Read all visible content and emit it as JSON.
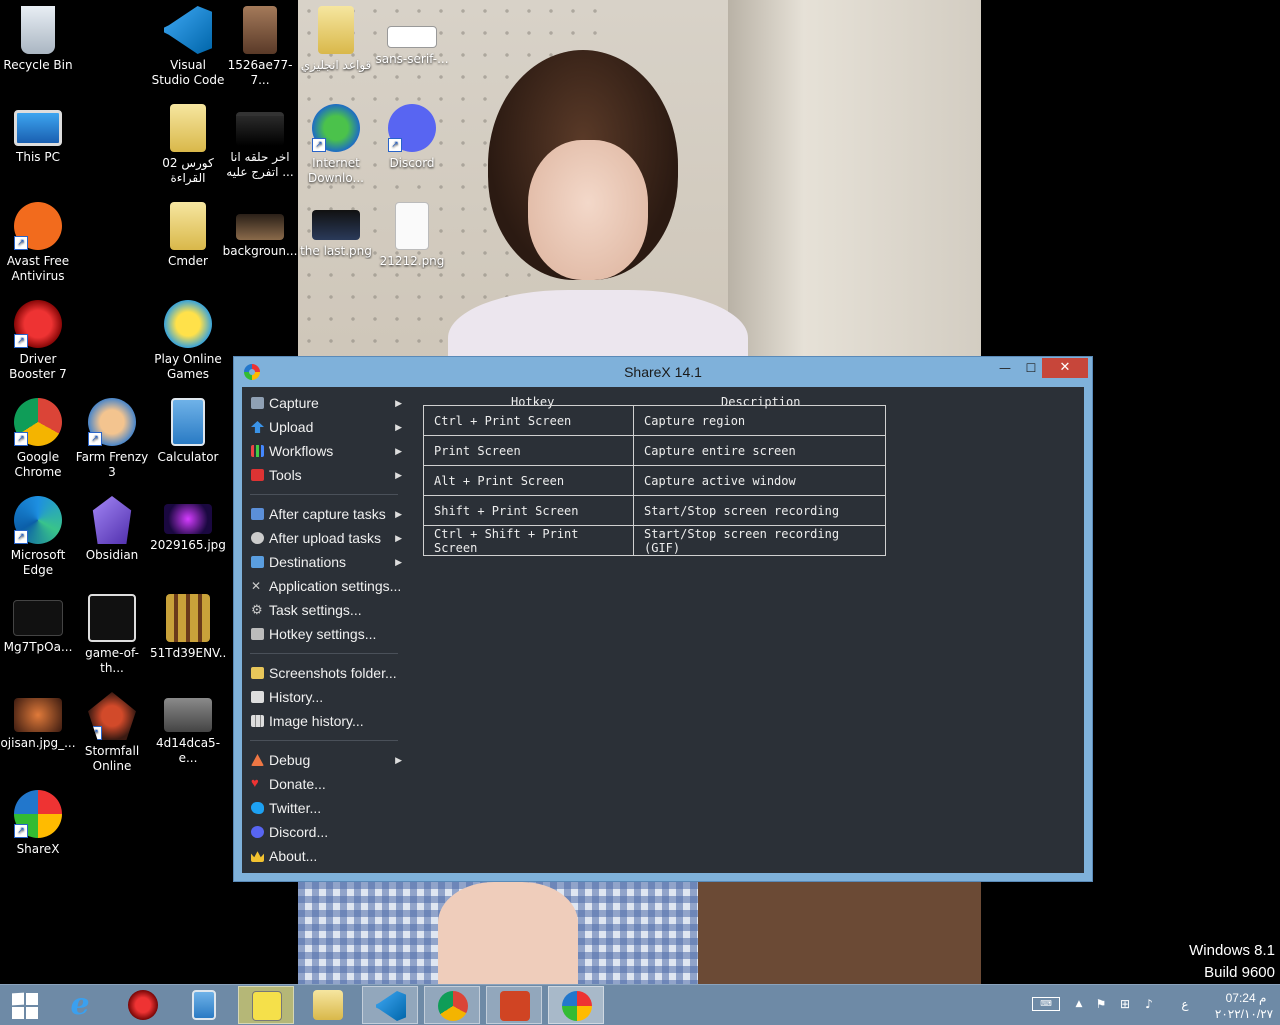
{
  "desktop": {
    "icons": [
      {
        "label": "Recycle Bin",
        "icon": "recycle-bin-icon"
      },
      {
        "label": "Visual Studio Code",
        "icon": "vscode-icon"
      },
      {
        "label": "1526ae77-7...",
        "icon": "image-thumbnail-icon"
      },
      {
        "label": "قواعد انجليزي",
        "icon": "folder-icon"
      },
      {
        "label": "sans-serif-...",
        "icon": "image-thumbnail-icon"
      },
      {
        "label": "This PC",
        "icon": "this-pc-icon"
      },
      {
        "label": "كورس 02 القراءة",
        "icon": "folder-icon"
      },
      {
        "label": "اخر حلقه انا اتفرج عليه ...",
        "icon": "image-thumbnail-icon"
      },
      {
        "label": "Internet Downlo...",
        "icon": "internet-download-manager-icon"
      },
      {
        "label": "Discord",
        "icon": "discord-icon"
      },
      {
        "label": "Avast Free Antivirus",
        "icon": "avast-icon"
      },
      {
        "label": "Cmder",
        "icon": "folder-icon"
      },
      {
        "label": "backgroun...",
        "icon": "image-thumbnail-icon"
      },
      {
        "label": "the last.png",
        "icon": "image-thumbnail-icon"
      },
      {
        "label": "21212.png",
        "icon": "png-file-icon"
      },
      {
        "label": "Driver Booster 7",
        "icon": "driver-booster-icon"
      },
      {
        "label": "Play Online Games",
        "icon": "games-icon"
      },
      {
        "label": "Google Chrome",
        "icon": "chrome-icon"
      },
      {
        "label": "Farm Frenzy 3",
        "icon": "farm-frenzy-icon"
      },
      {
        "label": "Calculator",
        "icon": "calculator-icon"
      },
      {
        "label": "Microsoft Edge",
        "icon": "edge-icon"
      },
      {
        "label": "Obsidian",
        "icon": "obsidian-icon"
      },
      {
        "label": "2029165.jpg",
        "icon": "image-thumbnail-icon"
      },
      {
        "label": "Mg7TpOa...",
        "icon": "image-thumbnail-icon"
      },
      {
        "label": "game-of-th...",
        "icon": "image-thumbnail-icon"
      },
      {
        "label": "51Td39ENV...",
        "icon": "image-thumbnail-icon"
      },
      {
        "label": "ojisan.jpg_...",
        "icon": "image-thumbnail-icon"
      },
      {
        "label": "Stormfall Online",
        "icon": "stormfall-icon"
      },
      {
        "label": "4d14dca5-e...",
        "icon": "image-thumbnail-icon"
      },
      {
        "label": "ShareX",
        "icon": "sharex-icon"
      }
    ]
  },
  "sharex": {
    "title": "ShareX 14.1",
    "menu": {
      "capture": "Capture",
      "upload": "Upload",
      "workflows": "Workflows",
      "tools": "Tools",
      "after_capture": "After capture tasks",
      "after_upload": "After upload tasks",
      "destinations": "Destinations",
      "app_settings": "Application settings...",
      "task_settings": "Task settings...",
      "hotkey_settings": "Hotkey settings...",
      "screenshots_folder": "Screenshots folder...",
      "history": "History...",
      "image_history": "Image history...",
      "debug": "Debug",
      "donate": "Donate...",
      "twitter": "Twitter...",
      "discord": "Discord...",
      "about": "About..."
    },
    "hotkeys": {
      "header_hotkey": "Hotkey",
      "header_description": "Description",
      "rows": [
        {
          "key": "Ctrl + Print Screen",
          "desc": "Capture region"
        },
        {
          "key": "Print Screen",
          "desc": "Capture entire screen"
        },
        {
          "key": "Alt + Print Screen",
          "desc": "Capture active window"
        },
        {
          "key": "Shift + Print Screen",
          "desc": "Start/Stop screen recording"
        },
        {
          "key": "Ctrl + Shift + Print Screen",
          "desc": "Start/Stop screen recording (GIF)"
        }
      ]
    }
  },
  "watermark": {
    "line1": "Windows 8.1",
    "line2": "Build 9600"
  },
  "taskbar": {
    "apps": [
      "internet-explorer-icon",
      "driver-booster-icon",
      "calculator-icon",
      "pia-player-icon",
      "file-explorer-icon",
      "vscode-icon",
      "chrome-icon",
      "office-icon",
      "sharex-icon"
    ],
    "language": "ع",
    "time": "07:24 م",
    "date": "٢٠٢٢/١٠/٢٧"
  },
  "colors": {
    "window_frame": "#7fb1da",
    "client_bg": "#2b3037",
    "close_button": "#c7463a",
    "taskbar": "#6e8aa6"
  }
}
